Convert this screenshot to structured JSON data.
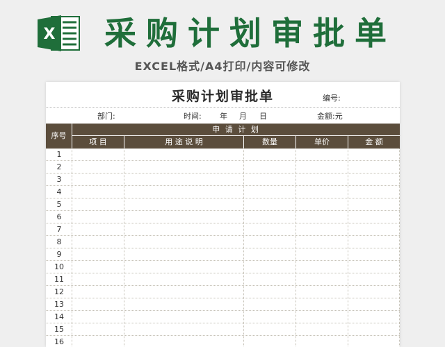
{
  "banner": {
    "title": "采购计划审批单",
    "subtitle": "EXCEL格式/A4打印/内容可修改",
    "icon_letter": "X",
    "brand_color": "#1f6e3a"
  },
  "form": {
    "title": "采购计划审批单",
    "serial_label": "编号:",
    "dept_label": "部门:",
    "time_label": "时间:",
    "year_label": "年",
    "month_label": "月",
    "day_label": "日",
    "amount_label": "金额:元",
    "header_color": "#5b4d3c",
    "columns": {
      "seq": "序号",
      "plan": "申 请 计 划",
      "item": "项 目",
      "usage": "用 途 说 明",
      "qty": "数量",
      "price": "单价",
      "amount": "金 额"
    },
    "rows": [
      "1",
      "2",
      "3",
      "4",
      "5",
      "6",
      "7",
      "8",
      "9",
      "10",
      "11",
      "12",
      "13",
      "14",
      "15",
      "16"
    ]
  }
}
